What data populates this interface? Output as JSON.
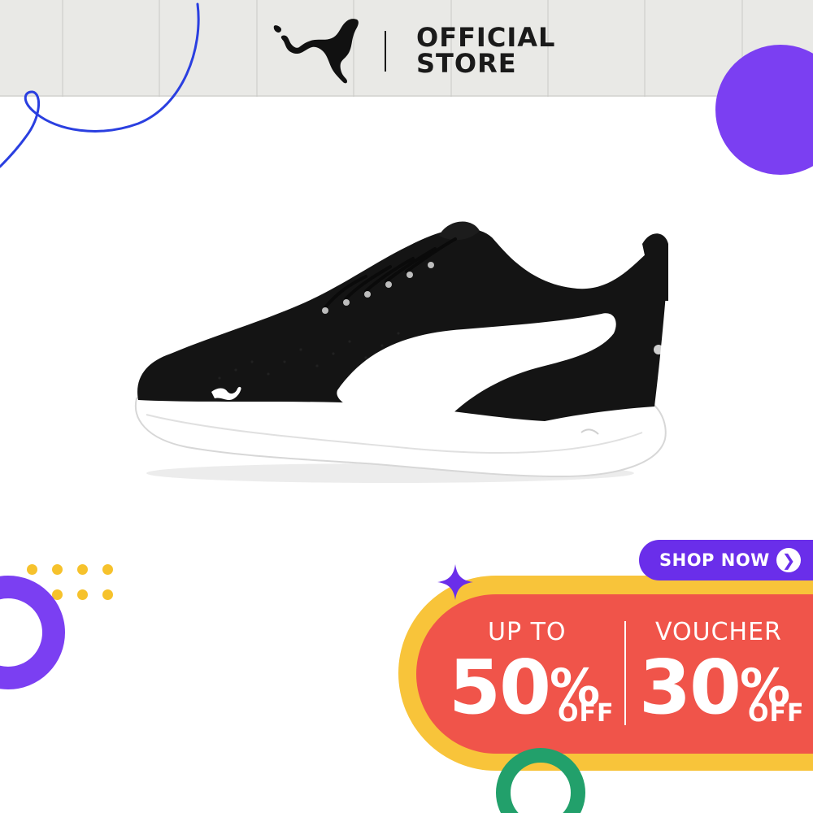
{
  "header": {
    "brand": "PUMA",
    "store_line1": "OFFICIAL",
    "store_line2": "STORE"
  },
  "promo": {
    "shop_now": "SHOP NOW",
    "shop_now_icon": "chevron-right-icon",
    "left_label": "UP TO",
    "left_value": "50",
    "left_unit": "%",
    "left_off": "OFF",
    "right_label": "VOUCHER",
    "right_value": "30",
    "right_unit": "%",
    "right_off": "OFF"
  },
  "colors": {
    "header_bg": "#e9e9e6",
    "purple": "#7b3ff2",
    "yellow": "#f8c43a",
    "red": "#f0544a",
    "green": "#22a06b",
    "line_blue": "#2a3fe0",
    "dots": "#f6c22c"
  }
}
